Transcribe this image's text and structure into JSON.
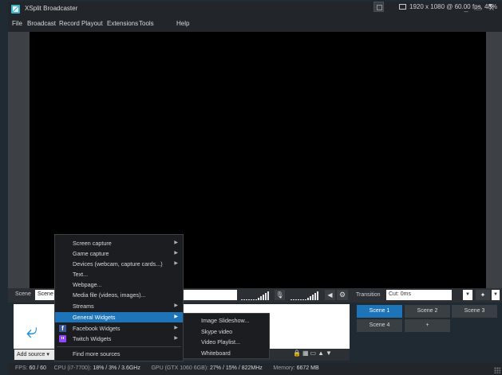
{
  "window": {
    "title": "XSplit Broadcaster",
    "controls": "_ □ X"
  },
  "menubar": {
    "items": [
      "File",
      "Broadcast",
      "Record",
      "Playout",
      "Extensions",
      "Tools",
      "Help"
    ],
    "resolution": "1920 x 1080 @ 60.00 fps, 48%"
  },
  "scene": {
    "label": "Scene",
    "name": "Scene"
  },
  "transition": {
    "label": "Transition",
    "value": "Cut: 0ms"
  },
  "scenes": [
    "Scene 1",
    "Scene 2",
    "Scene 3",
    "Scene 4",
    "+"
  ],
  "sources": {
    "add_source_label": "Add source ▾"
  },
  "context_menu": {
    "items": [
      "Screen capture",
      "Game capture",
      "Devices (webcam, capture cards...)",
      "Text...",
      "Webpage...",
      "Media file (videos, images)...",
      "Streams",
      "General Widgets",
      "Facebook Widgets",
      "Twitch Widgets",
      "Find more sources"
    ]
  },
  "submenu": {
    "items": [
      "Image Slideshow...",
      "Skype video",
      "Video Playlist...",
      "Whiteboard"
    ]
  },
  "status": {
    "fps_label": "FPS:",
    "fps_value": "60 / 60",
    "cpu_label": "CPU (i7-7700):",
    "cpu_value": "18% / 3% / 3.6GHz",
    "gpu_label": "GPU (GTX 1060 6GB):",
    "gpu_value": "27% / 15% / 822MHz",
    "mem_label": "Memory:",
    "mem_value": "6672 MB"
  },
  "colors": {
    "accent": "#1d74b8",
    "logo": "#3fb4c6",
    "background": "#1f2a33",
    "preview": "#000000"
  }
}
